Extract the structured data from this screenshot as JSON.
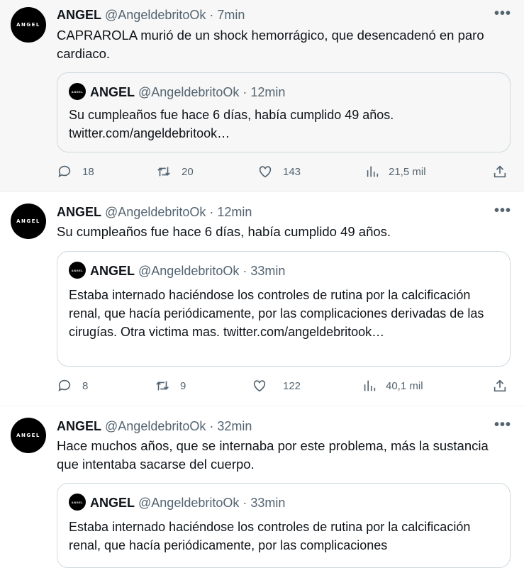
{
  "tweets": [
    {
      "name": "ANGEL",
      "handle": "@AngeldebritoOk",
      "time": "· 7min",
      "avatar_text": "ANGEL",
      "text": "CAPRAROLA murió de un shock hemorrágico, que desencadenó en paro cardiaco.",
      "quote": {
        "name": "ANGEL",
        "handle": "@AngeldebritoOk",
        "time": "· 12min",
        "avatar_text": "ANGEL",
        "text": "Su cumpleaños fue hace 6 días, había cumplido 49 años. twitter.com/angeldebritook…"
      },
      "replies": "18",
      "retweets": "20",
      "likes": "143",
      "views": "21,5 mil"
    },
    {
      "name": "ANGEL",
      "handle": "@AngeldebritoOk",
      "time": "· 12min",
      "avatar_text": "ANGEL",
      "text": "Su cumpleaños fue hace 6 días, había cumplido 49 años.",
      "quote": {
        "name": "ANGEL",
        "handle": "@AngeldebritoOk",
        "time": "· 33min",
        "avatar_text": "ANGEL",
        "text": "Estaba internado haciéndose los controles de rutina por la calcificación renal, que hacía periódicamente, por las complicaciones derivadas de las cirugías. Otra victima mas. twitter.com/angeldebritook…"
      },
      "replies": "8",
      "retweets": "9",
      "likes": "122",
      "views": "40,1 mil"
    },
    {
      "name": "ANGEL",
      "handle": "@AngeldebritoOk",
      "time": "· 32min",
      "avatar_text": "ANGEL",
      "text": "Hace muchos años, que se internaba por este problema, más la sustancia que intentaba sacarse del cuerpo.",
      "quote": {
        "name": "ANGEL",
        "handle": "@AngeldebritoOk",
        "time": "· 33min",
        "avatar_text": "ANGEL",
        "text": "Estaba internado haciéndose los controles de rutina por la calcificación renal, que hacía periódicamente, por las complicaciones"
      }
    }
  ],
  "icons": {
    "more": "more-icon",
    "reply": "reply-icon",
    "retweet": "retweet-icon",
    "like": "heart-icon",
    "views": "views-icon",
    "share": "share-icon"
  },
  "colors": {
    "text": "#0f1419",
    "secondary": "#536471",
    "border": "#cfd9de",
    "highlight_bg": "#f7f7f7"
  }
}
